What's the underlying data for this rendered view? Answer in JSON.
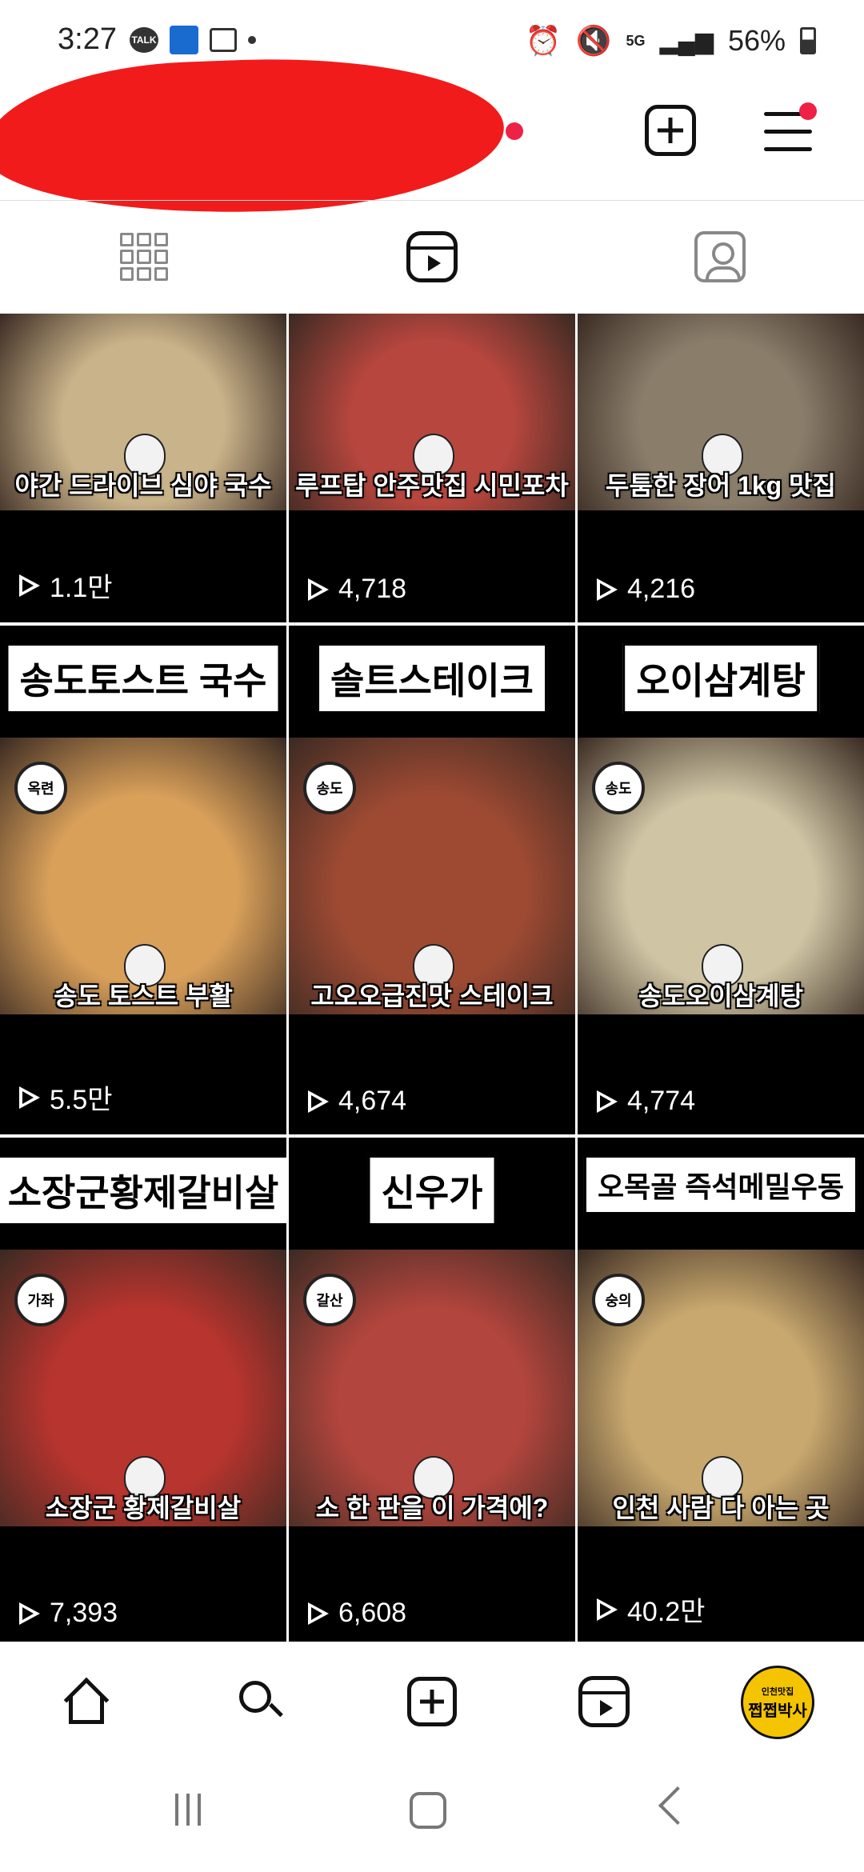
{
  "status_bar": {
    "time": "3:27",
    "talk_chip": "TALK",
    "network": "5G",
    "battery": "56%"
  },
  "tabs": [
    {
      "name": "grid",
      "icon": "grid-icon",
      "active": false
    },
    {
      "name": "reels",
      "icon": "reels-icon",
      "active": true
    },
    {
      "name": "tagged",
      "icon": "tagged-icon",
      "active": false
    }
  ],
  "reels": [
    {
      "title": "",
      "caption": "야간 드라이브 심야 국수",
      "location": "",
      "views": "1.1만",
      "color": "#c9b38a"
    },
    {
      "title": "",
      "caption": "루프탑 안주맛집 시민포차",
      "location": "",
      "views": "4,718",
      "color": "#b7463e"
    },
    {
      "title": "",
      "caption": "두툼한 장어 1kg 맛집",
      "location": "",
      "views": "4,216",
      "color": "#8a7e6b"
    },
    {
      "title": "송도토스트 국수",
      "caption": "송도 토스트 부활",
      "location": "옥련",
      "views": "5.5만",
      "color": "#d9a05a"
    },
    {
      "title": "솔트스테이크",
      "caption": "고오오급진맛 스테이크",
      "location": "송도",
      "views": "4,674",
      "color": "#9e4a33"
    },
    {
      "title": "오이삼계탕",
      "caption": "송도오이삼계탕",
      "location": "송도",
      "views": "4,774",
      "color": "#cfc5a4"
    },
    {
      "title": "소장군황제갈비살",
      "caption": "소장군 황제갈비살",
      "location": "가좌",
      "views": "7,393",
      "color": "#b8342e"
    },
    {
      "title": "신우가",
      "caption": "소 한 판을 이 가격에?",
      "location": "갈산",
      "views": "6,608",
      "color": "#b2453d"
    },
    {
      "title": "오목골 즉석메밀우동",
      "caption": "인천 사람 다 아는 곳",
      "location": "숭의",
      "views": "40.2만",
      "color": "#c8a86e"
    }
  ],
  "profile": {
    "line1": "인천맛집",
    "line2": "쩝쩝박사"
  }
}
